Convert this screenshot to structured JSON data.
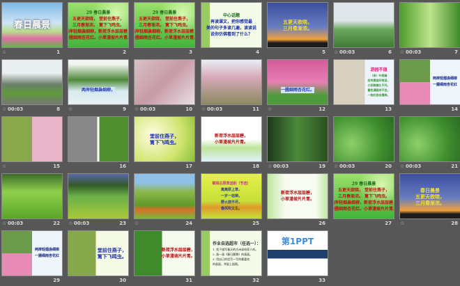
{
  "view": "slide-sorter",
  "icon_names": {
    "transition": "transition-icon"
  },
  "slides": [
    {
      "num": "1",
      "transition": true,
      "timing": "",
      "title": "",
      "lines": [
        "春日晨景"
      ]
    },
    {
      "num": "2",
      "transition": false,
      "timing": "",
      "title": "29 春日晨景",
      "lines": [
        "五更天欲晓，  堂前住燕子，",
        "三月春渐浓。  篱下飞鸣虫。",
        "两岸轻烟袅细柳，新荷浮水层层碧，",
        "一圃细雨杏花红。小草漫坡片片青。"
      ]
    },
    {
      "num": "3",
      "transition": false,
      "timing": "",
      "title": "29 春日晨景",
      "lines": [
        "五更天欲晓，  堂前住燕子，",
        "三月春渐浓。  篱下飞鸣虫。",
        "两岸轻烟袅细柳，新荷浮水层层碧，",
        "一圃细雨杏花红。小草漫坡片片青。"
      ]
    },
    {
      "num": "4",
      "transition": false,
      "timing": "",
      "title": "中心话题",
      "lines": [
        "再读课文，把你感觉最",
        "美的句子多读几遍，读读说",
        "说你仿佛看到了什么？"
      ]
    },
    {
      "num": "5",
      "transition": false,
      "timing": "",
      "title": "",
      "lines": [
        "五更天欲晓，",
        "三月春渐浓。"
      ]
    },
    {
      "num": "6",
      "transition": true,
      "timing": "00:03",
      "title": "",
      "lines": []
    },
    {
      "num": "7",
      "transition": true,
      "timing": "00:03",
      "title": "",
      "lines": []
    },
    {
      "num": "8",
      "transition": true,
      "timing": "00:03",
      "title": "",
      "lines": []
    },
    {
      "num": "9",
      "transition": true,
      "timing": "",
      "title": "",
      "lines": [
        "两岸轻烟袅细柳，"
      ]
    },
    {
      "num": "10",
      "transition": true,
      "timing": "00:03",
      "title": "",
      "lines": []
    },
    {
      "num": "11",
      "transition": true,
      "timing": "00:03",
      "title": "",
      "lines": []
    },
    {
      "num": "12",
      "transition": true,
      "timing": "",
      "title": "",
      "lines": [
        "一圃细雨杏花红。"
      ]
    },
    {
      "num": "13",
      "transition": false,
      "timing": "",
      "title": "游园不值",
      "lines": [
        "（宋）叶绍翁",
        "应怜屐齿印苍苔，",
        "小扣柴扉久不开。",
        "春色满园关不住，",
        "一枝红杏出墙来。"
      ]
    },
    {
      "num": "14",
      "transition": false,
      "timing": "",
      "title": "",
      "lines": [
        "两岸轻烟袅细柳",
        "一圃细雨杏花红"
      ]
    },
    {
      "num": "15",
      "transition": true,
      "timing": "",
      "title": "",
      "lines": []
    },
    {
      "num": "16",
      "transition": false,
      "timing": "",
      "title": "",
      "lines": []
    },
    {
      "num": "17",
      "transition": false,
      "timing": "",
      "title": "",
      "lines": [
        "堂前住燕子，",
        "篱下飞鸣虫。"
      ]
    },
    {
      "num": "18",
      "transition": false,
      "timing": "",
      "title": "",
      "lines": [
        "新荷浮水层层碧，",
        "小草漫坡片片青。"
      ]
    },
    {
      "num": "19",
      "transition": true,
      "timing": "00:03",
      "title": "",
      "lines": []
    },
    {
      "num": "20",
      "transition": true,
      "timing": "00:03",
      "title": "",
      "lines": []
    },
    {
      "num": "21",
      "transition": true,
      "timing": "00:03",
      "title": "",
      "lines": []
    },
    {
      "num": "22",
      "transition": true,
      "timing": "00:03",
      "title": "",
      "lines": []
    },
    {
      "num": "23",
      "transition": true,
      "timing": "00:03",
      "title": "",
      "lines": []
    },
    {
      "num": "24",
      "transition": true,
      "timing": "",
      "title": "",
      "lines": []
    },
    {
      "num": "25",
      "transition": false,
      "timing": "",
      "title": "赋得古原草送别（节选）",
      "lines": [
        "离离原上草，",
        "一岁一枯荣。",
        "野火烧不尽，",
        "春风吹又生。"
      ]
    },
    {
      "num": "26",
      "transition": false,
      "timing": "",
      "title": "",
      "lines": [
        "新荷浮水层层碧，",
        "小草漫坡片片青。"
      ]
    },
    {
      "num": "27",
      "transition": false,
      "timing": "",
      "title": "29 春日晨景",
      "lines": [
        "五更天欲晓，  堂前住燕子，",
        "三月春渐浓。  篱下飞鸣虫。",
        "两岸轻烟袅细柳，新荷浮水层层碧，",
        "一圃细雨杏花红。小草漫坡片片青。"
      ]
    },
    {
      "num": "28",
      "transition": true,
      "timing": "",
      "title": "",
      "lines": [
        "春日晨景",
        "五更天欲晓，",
        "三月春渐浓。"
      ]
    },
    {
      "num": "29",
      "transition": false,
      "timing": "",
      "title": "",
      "lines": [
        "两岸轻烟袅细柳",
        "一圃细雨杏花红"
      ]
    },
    {
      "num": "30",
      "transition": false,
      "timing": "",
      "title": "",
      "lines": [
        "堂前住燕子，",
        "篱下飞鸣虫。"
      ]
    },
    {
      "num": "31",
      "transition": false,
      "timing": "",
      "title": "",
      "lines": [
        "新荷浮水层层碧，",
        "小草漫坡片片青。"
      ]
    },
    {
      "num": "32",
      "transition": false,
      "timing": "",
      "title": "作业自选超市（任选一）：",
      "lines": [
        "1. 找下描写春天的古诗读给家人听。",
        "2. 画一画《春日晨景》的画面。",
        "3. 用自己的话写一写你最喜欢",
        "的画面，并配上插图。"
      ]
    },
    {
      "num": "33",
      "transition": false,
      "timing": "",
      "title": "",
      "lines": [
        "第1PPT"
      ]
    }
  ]
}
